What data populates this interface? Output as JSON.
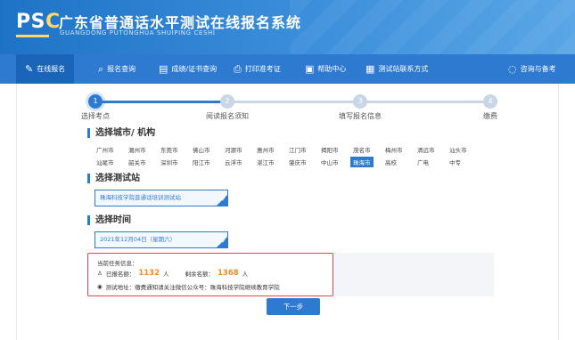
{
  "brand": {
    "logo_left": "PS",
    "logo_mid": "C",
    "title": "广东省普通话水平测试在线报名系统",
    "subtitle": "GUANGDONG PUTONGHUA SHUIPING CESHI"
  },
  "nav": {
    "items": [
      {
        "label": "在线报名",
        "icon": "edit-icon"
      },
      {
        "label": "报名查询",
        "icon": "search-icon"
      },
      {
        "label": "成绩/证书查询",
        "icon": "certificate-icon"
      },
      {
        "label": "打印准考证",
        "icon": "printer-icon"
      },
      {
        "label": "帮助中心",
        "icon": "help-icon"
      },
      {
        "label": "测试站联系方式",
        "icon": "contact-icon"
      }
    ],
    "right": {
      "label": "咨询与备考",
      "icon": "chat-icon"
    }
  },
  "steps": [
    {
      "num": "1",
      "label": "选择考点"
    },
    {
      "num": "2",
      "label": "阅读报名须知"
    },
    {
      "num": "3",
      "label": "填写报名信息"
    },
    {
      "num": "4",
      "label": "缴费"
    }
  ],
  "city_section": {
    "title": "选择城市/ 机构",
    "row1": [
      "广州市",
      "潮州市",
      "东莞市",
      "佛山市",
      "河源市",
      "惠州市",
      "江门市",
      "揭阳市",
      "茂名市",
      "梅州市",
      "清远市",
      "汕头市"
    ],
    "row2": [
      "汕尾市",
      "韶关市",
      "深圳市",
      "阳江市",
      "云浮市",
      "湛江市",
      "肇庆市",
      "中山市",
      "珠海市",
      "高校",
      "广电",
      "中专"
    ],
    "selected": "珠海市"
  },
  "station_section": {
    "title": "选择测试站",
    "value": "珠海科技学院普通话培训测试站"
  },
  "time_section": {
    "title": "选择时间",
    "value": "2021年12月04日（星期六）"
  },
  "info": {
    "title": "当前任务信息：",
    "registered_label": "已报名额：",
    "registered": "1132",
    "unit1": "人",
    "remaining_label": "剩余名额：",
    "remaining": "1368",
    "unit2": "人",
    "address": "测试地址：缴费通知请关注微信公众号：珠海科技学院继续教育学院"
  },
  "next_label": "下一步"
}
